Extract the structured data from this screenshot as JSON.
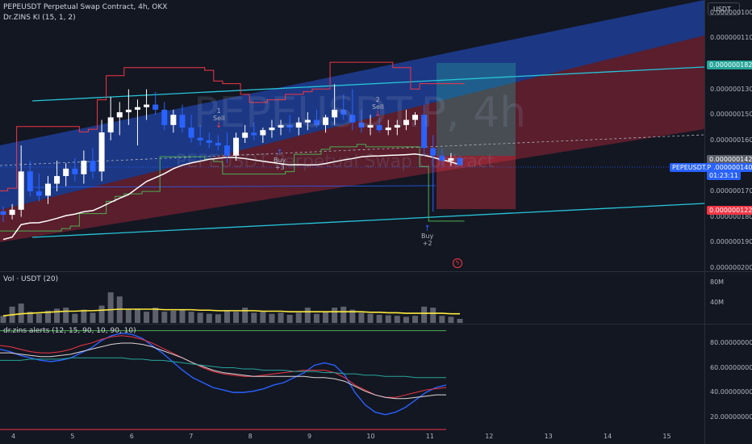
{
  "header": {
    "symbol_title": "PEPEUSDT Perpetual Swap Contract, 4h, OKX",
    "indicator_1": "Dr.ZINS KI (15, 1, 2)",
    "volume_legend": "Vol · USDT (20)",
    "oscillator_legend": "dr.zins alerts (12, 15, 90, 10, 90, 10)"
  },
  "watermark": {
    "line1": "PEPEUSDT.P, 4h",
    "line2": "PEPEUSDT Perpetual Swap Contract"
  },
  "currency_button": "USDT",
  "price_axis": {
    "ticks": [
      "0.0000002000",
      "0.0000001900",
      "0.0000001800",
      "0.0000001700",
      "0.0000001600",
      "0.0000001500",
      "0.0000001300",
      "0.0000001200",
      "0.0000001100",
      "0.0000001000"
    ]
  },
  "price_tags": {
    "teal_line": "0.0000001826",
    "current_gray": "0.0000001429",
    "last_price": "0.0000001403",
    "countdown": "01:23:11",
    "symbol_tag": "PEPEUSDT.P",
    "red_line": "0.0000001229"
  },
  "volume_axis": {
    "ticks": [
      "80M",
      "40M"
    ]
  },
  "oscillator_axis": {
    "ticks": [
      "80.0000000000",
      "60.0000000000",
      "40.0000000000",
      "20.0000000000"
    ]
  },
  "time_axis": {
    "ticks": [
      "4",
      "5",
      "6",
      "7",
      "8",
      "9",
      "10",
      "11",
      "12",
      "13",
      "14",
      "15"
    ]
  },
  "signals": [
    {
      "top": "1",
      "text": "Sell",
      "arrow": "↓",
      "kind": "sell"
    },
    {
      "top": "2",
      "text": "Sell",
      "arrow": "↓",
      "kind": "sell"
    },
    {
      "top": "↑",
      "text": "Buy",
      "arrow": "+3",
      "kind": "buy"
    },
    {
      "top": "↑",
      "text": "Buy",
      "arrow": "+2",
      "kind": "buy"
    }
  ],
  "lightning_icon": "lightning-icon",
  "colors": {
    "background": "#131722",
    "up_candle": "#ffffff",
    "down_candle": "#2962ff",
    "teal": "#26c6da",
    "red_line": "#f23645",
    "green_line": "#4caf50",
    "volume_ma": "#ffeb3b"
  },
  "chart_data": [
    {
      "type": "candlestick",
      "title": "PEPEUSDT Perpetual Swap Contract, 4h, OKX",
      "ylim": [
        9.9e-08,
        2.05e-07
      ],
      "y_ticks": [
        1e-07,
        1.1e-07,
        1.2e-07,
        1.3e-07,
        1.5e-07,
        1.6e-07,
        1.7e-07,
        1.8e-07,
        1.9e-07,
        2e-07
      ],
      "x_ticks": [
        "4",
        "5",
        "6",
        "7",
        "8",
        "9",
        "10",
        "11",
        "12",
        "13",
        "14",
        "15"
      ],
      "candles": [
        {
          "o": 1.222e-07,
          "h": 1.24e-07,
          "l": 1.18e-07,
          "c": 1.208e-07
        },
        {
          "o": 1.208e-07,
          "h": 1.25e-07,
          "l": 1.19e-07,
          "c": 1.228e-07
        },
        {
          "o": 1.228e-07,
          "h": 1.48e-07,
          "l": 1.2e-07,
          "c": 1.378e-07
        },
        {
          "o": 1.378e-07,
          "h": 1.42e-07,
          "l": 1.28e-07,
          "c": 1.3e-07
        },
        {
          "o": 1.3e-07,
          "h": 1.37e-07,
          "l": 1.26e-07,
          "c": 1.283e-07
        },
        {
          "o": 1.283e-07,
          "h": 1.36e-07,
          "l": 1.25e-07,
          "c": 1.33e-07
        },
        {
          "o": 1.33e-07,
          "h": 1.42e-07,
          "l": 1.3e-07,
          "c": 1.36e-07
        },
        {
          "o": 1.36e-07,
          "h": 1.41e-07,
          "l": 1.32e-07,
          "c": 1.389e-07
        },
        {
          "o": 1.389e-07,
          "h": 1.43e-07,
          "l": 1.34e-07,
          "c": 1.367e-07
        },
        {
          "o": 1.367e-07,
          "h": 1.46e-07,
          "l": 1.33e-07,
          "c": 1.42e-07
        },
        {
          "o": 1.42e-07,
          "h": 1.47e-07,
          "l": 1.35e-07,
          "c": 1.378e-07
        },
        {
          "o": 1.378e-07,
          "h": 1.58e-07,
          "l": 1.34e-07,
          "c": 1.531e-07
        },
        {
          "o": 1.531e-07,
          "h": 1.67e-07,
          "l": 1.5e-07,
          "c": 1.59e-07
        },
        {
          "o": 1.59e-07,
          "h": 1.65e-07,
          "l": 1.52e-07,
          "c": 1.61e-07
        },
        {
          "o": 1.61e-07,
          "h": 1.7e-07,
          "l": 1.56e-07,
          "c": 1.62e-07
        },
        {
          "o": 1.62e-07,
          "h": 1.66e-07,
          "l": 1.48e-07,
          "c": 1.63e-07
        },
        {
          "o": 1.63e-07,
          "h": 1.7e-07,
          "l": 1.58e-07,
          "c": 1.64e-07
        },
        {
          "o": 1.64e-07,
          "h": 1.69e-07,
          "l": 1.6e-07,
          "c": 1.62e-07
        },
        {
          "o": 1.62e-07,
          "h": 1.65e-07,
          "l": 1.54e-07,
          "c": 1.56e-07
        },
        {
          "o": 1.56e-07,
          "h": 1.62e-07,
          "l": 1.53e-07,
          "c": 1.6e-07
        },
        {
          "o": 1.6e-07,
          "h": 1.64e-07,
          "l": 1.53e-07,
          "c": 1.55e-07
        },
        {
          "o": 1.55e-07,
          "h": 1.6e-07,
          "l": 1.49e-07,
          "c": 1.51e-07
        },
        {
          "o": 1.51e-07,
          "h": 1.56e-07,
          "l": 1.48e-07,
          "c": 1.5e-07
        },
        {
          "o": 1.5e-07,
          "h": 1.53e-07,
          "l": 1.47e-07,
          "c": 1.49e-07
        },
        {
          "o": 1.49e-07,
          "h": 1.52e-07,
          "l": 1.46e-07,
          "c": 1.48e-07
        },
        {
          "o": 1.48e-07,
          "h": 1.53e-07,
          "l": 1.41e-07,
          "c": 1.44e-07
        },
        {
          "o": 1.44e-07,
          "h": 1.53e-07,
          "l": 1.42e-07,
          "c": 1.51e-07
        },
        {
          "o": 1.51e-07,
          "h": 1.56e-07,
          "l": 1.49e-07,
          "c": 1.53e-07
        },
        {
          "o": 1.53e-07,
          "h": 1.57e-07,
          "l": 1.5e-07,
          "c": 1.52e-07
        },
        {
          "o": 1.52e-07,
          "h": 1.55e-07,
          "l": 1.49e-07,
          "c": 1.54e-07
        },
        {
          "o": 1.54e-07,
          "h": 1.58e-07,
          "l": 1.51e-07,
          "c": 1.55e-07
        },
        {
          "o": 1.55e-07,
          "h": 1.58e-07,
          "l": 1.52e-07,
          "c": 1.56e-07
        },
        {
          "o": 1.56e-07,
          "h": 1.6e-07,
          "l": 1.53e-07,
          "c": 1.55e-07
        },
        {
          "o": 1.55e-07,
          "h": 1.59e-07,
          "l": 1.52e-07,
          "c": 1.57e-07
        },
        {
          "o": 1.57e-07,
          "h": 1.61e-07,
          "l": 1.54e-07,
          "c": 1.58e-07
        },
        {
          "o": 1.58e-07,
          "h": 1.62e-07,
          "l": 1.55e-07,
          "c": 1.56e-07
        },
        {
          "o": 1.56e-07,
          "h": 1.6e-07,
          "l": 1.53e-07,
          "c": 1.59e-07
        },
        {
          "o": 1.59e-07,
          "h": 1.72e-07,
          "l": 1.56e-07,
          "c": 1.62e-07
        },
        {
          "o": 1.62e-07,
          "h": 1.68e-07,
          "l": 1.58e-07,
          "c": 1.6e-07
        },
        {
          "o": 1.6e-07,
          "h": 1.7e-07,
          "l": 1.54e-07,
          "c": 1.57e-07
        },
        {
          "o": 1.57e-07,
          "h": 1.62e-07,
          "l": 1.53e-07,
          "c": 1.55e-07
        },
        {
          "o": 1.55e-07,
          "h": 1.6e-07,
          "l": 1.52e-07,
          "c": 1.56e-07
        },
        {
          "o": 1.56e-07,
          "h": 1.59e-07,
          "l": 1.53e-07,
          "c": 1.54e-07
        },
        {
          "o": 1.54e-07,
          "h": 1.58e-07,
          "l": 1.52e-07,
          "c": 1.55e-07
        },
        {
          "o": 1.55e-07,
          "h": 1.58e-07,
          "l": 1.52e-07,
          "c": 1.56e-07
        },
        {
          "o": 1.56e-07,
          "h": 1.62e-07,
          "l": 1.54e-07,
          "c": 1.58e-07
        },
        {
          "o": 1.58e-07,
          "h": 1.61e-07,
          "l": 1.56e-07,
          "c": 1.6e-07
        },
        {
          "o": 1.6e-07,
          "h": 1.64e-07,
          "l": 1.44e-07,
          "c": 1.47e-07
        },
        {
          "o": 1.47e-07,
          "h": 1.52e-07,
          "l": 1.22e-07,
          "c": 1.44e-07
        },
        {
          "o": 1.44e-07,
          "h": 1.47e-07,
          "l": 1.4e-07,
          "c": 1.42e-07
        },
        {
          "o": 1.42e-07,
          "h": 1.45e-07,
          "l": 1.4e-07,
          "c": 1.43e-07
        },
        {
          "o": 1.43e-07,
          "h": 1.44e-07,
          "l": 1.4e-07,
          "c": 1.403e-07
        }
      ]
    },
    {
      "type": "bar",
      "title": "Vol · USDT (20)",
      "ylim": [
        0,
        100000000
      ],
      "y_ticks": [
        "80M",
        "40M"
      ],
      "values": [
        14000000,
        32000000,
        38000000,
        22000000,
        18000000,
        24000000,
        28000000,
        30000000,
        18000000,
        26000000,
        20000000,
        34000000,
        60000000,
        52000000,
        26000000,
        28000000,
        22000000,
        30000000,
        22000000,
        24000000,
        26000000,
        22000000,
        20000000,
        18000000,
        17000000,
        24000000,
        22000000,
        30000000,
        20000000,
        22000000,
        18000000,
        20000000,
        16000000,
        20000000,
        30000000,
        18000000,
        22000000,
        30000000,
        32000000,
        26000000,
        20000000,
        18000000,
        16000000,
        15000000,
        14000000,
        12000000,
        14000000,
        32000000,
        30000000,
        14000000,
        12000000,
        8000000
      ],
      "ma": [
        14000000,
        16000000,
        18000000,
        19000000,
        20000000,
        21000000,
        22000000,
        23000000,
        23000000,
        24000000,
        24000000,
        25000000,
        26000000,
        27000000,
        27000000,
        27000000,
        27000000,
        27000000,
        26000000,
        26000000,
        26000000,
        26000000,
        25000000,
        25000000,
        24000000,
        24000000,
        24000000,
        24000000,
        24000000,
        23000000,
        23000000,
        23000000,
        22000000,
        22000000,
        22000000,
        22000000,
        22000000,
        22000000,
        22000000,
        22000000,
        22000000,
        21000000,
        21000000,
        20000000,
        20000000,
        19000000,
        19000000,
        19000000,
        19000000,
        19000000,
        18000000,
        18000000
      ]
    },
    {
      "type": "line",
      "title": "dr.zins alerts (12, 15, 90, 10, 90, 10)",
      "ylim": [
        10,
        95
      ],
      "y_ticks": [
        80,
        60,
        40,
        20
      ],
      "series": [
        {
          "values": [
            75,
            73,
            70,
            68,
            66,
            65,
            66,
            68,
            72,
            76,
            82,
            86,
            88,
            87,
            84,
            78,
            72,
            65,
            58,
            52,
            48,
            44,
            42,
            40,
            40,
            41,
            43,
            46,
            48,
            52,
            56,
            62,
            64,
            62,
            54,
            40,
            30,
            24,
            22,
            24,
            28,
            34,
            40,
            44,
            46
          ]
        },
        {
          "values": [
            78,
            77,
            75,
            73,
            72,
            72,
            73,
            75,
            78,
            80,
            83,
            85,
            86,
            85,
            83,
            80,
            76,
            72,
            68,
            64,
            60,
            57,
            55,
            54,
            53,
            53,
            54,
            55,
            56,
            57,
            58,
            58,
            58,
            56,
            52,
            46,
            42,
            38,
            36,
            36,
            38,
            40,
            42,
            43,
            44
          ]
        },
        {
          "values": [
            72,
            72,
            71,
            70,
            69,
            69,
            70,
            71,
            73,
            75,
            77,
            79,
            80,
            80,
            79,
            77,
            74,
            71,
            68,
            64,
            61,
            58,
            56,
            55,
            54,
            53,
            53,
            53,
            53,
            53,
            53,
            52,
            52,
            51,
            49,
            45,
            41,
            38,
            36,
            35,
            35,
            36,
            37,
            38,
            38
          ]
        },
        {
          "values": [
            66,
            66,
            66,
            67,
            67,
            67,
            67,
            68,
            68,
            68,
            68,
            68,
            68,
            67,
            67,
            66,
            66,
            65,
            64,
            63,
            62,
            61,
            60,
            60,
            59,
            59,
            58,
            58,
            58,
            57,
            57,
            57,
            56,
            56,
            55,
            55,
            54,
            54,
            53,
            53,
            53,
            52,
            52,
            52,
            52
          ]
        }
      ]
    }
  ]
}
